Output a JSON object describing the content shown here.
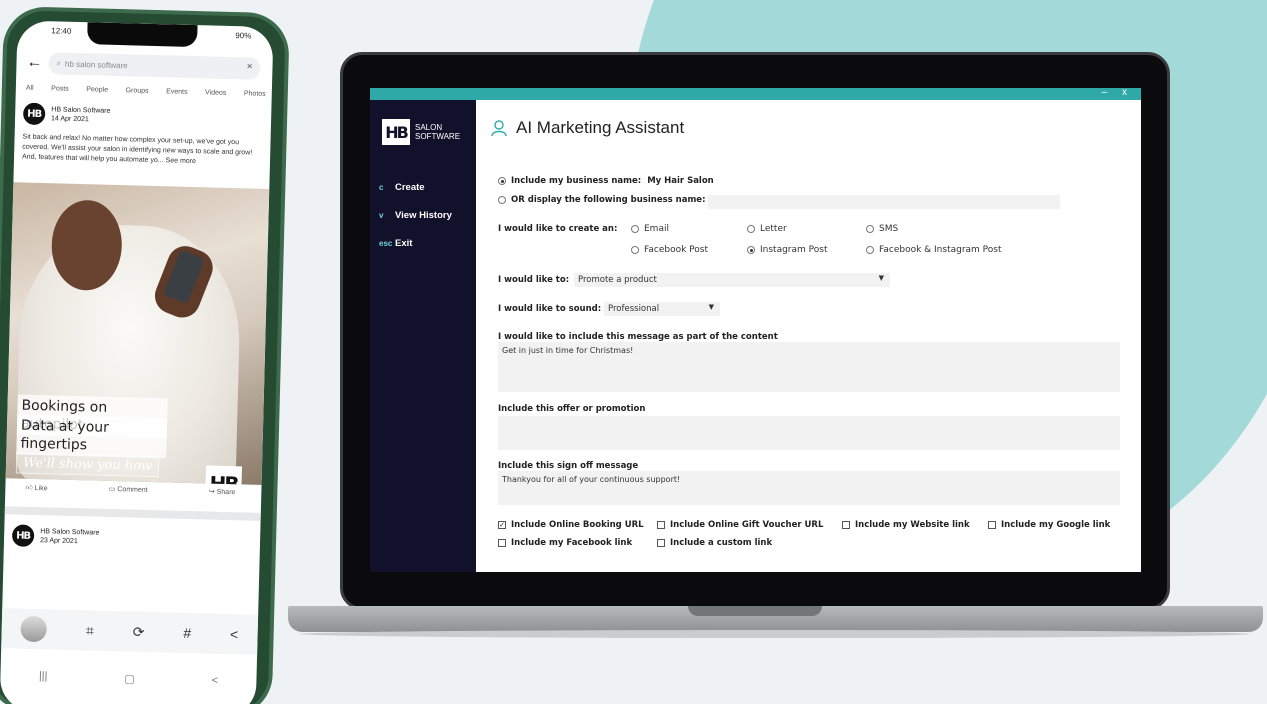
{
  "colors": {
    "accent": "#2fa9a7",
    "sidebar": "#12112b",
    "background_circle": "#a3d9d8"
  },
  "app": {
    "logo_mark": "HB",
    "logo_line1": "SALON",
    "logo_line2": "SOFTWARE",
    "window_controls": "– x",
    "nav": [
      {
        "key": "c",
        "label": "Create"
      },
      {
        "key": "v",
        "label": "View History"
      },
      {
        "key": "esc",
        "label": "Exit"
      }
    ],
    "title": "AI Marketing Assistant",
    "title_icon": "person-outline-icon"
  },
  "form": {
    "include_business_name_label": "Include my business name:",
    "business_name": "My Hair Salon",
    "display_other_name_label": "OR display the following business name:",
    "display_other_name_value": "",
    "create_label": "I would like to create an:",
    "create_options": [
      "Email",
      "Letter",
      "SMS",
      "Facebook Post",
      "Instagram Post",
      "Facebook & Instagram Post"
    ],
    "create_selected": "Instagram Post",
    "like_to_label": "I would like to:",
    "like_to_value": "Promote a product",
    "sound_label": "I would like to sound:",
    "sound_value": "Professional",
    "message_label": "I would like to include this message as part of the content",
    "message_value": "Get in just in time for Christmas!",
    "offer_label": "Include this offer or promotion",
    "offer_value": "",
    "signoff_label": "Include this sign off message",
    "signoff_value": "Thankyou for all of your continuous support!",
    "checkboxes": [
      {
        "label": "Include Online Booking URL",
        "checked": true
      },
      {
        "label": "Include Online Gift Voucher URL",
        "checked": false
      },
      {
        "label": "Include my Website link",
        "checked": false
      },
      {
        "label": "Include my Google link",
        "checked": false
      },
      {
        "label": "Include my Facebook link",
        "checked": false
      },
      {
        "label": "Include a custom link",
        "checked": false
      }
    ]
  },
  "phone": {
    "time": "12:40",
    "status_right": "90%",
    "search_text": "hb salon software",
    "tabs": [
      "All",
      "Posts",
      "People",
      "Groups",
      "Events",
      "Videos",
      "Photos"
    ],
    "post_author": "HB Salon Software",
    "post_date": "14 Apr 2021",
    "post_text": "Sit back and relax! No matter how complex your set-up, we've got you covered. We'll assist your salon in identifying new ways to scale and grow! And, features that will help you automate yo... See more",
    "overlay_line1": "Bookings on autopilot",
    "overlay_line2": "Data at your fingertips",
    "overlay_script": "We'll show you how",
    "brand_mark": "HB",
    "actions": [
      "Like",
      "Comment",
      "Share"
    ],
    "post2_author": "HB Salon Software",
    "post2_date": "23 Apr 2021"
  }
}
